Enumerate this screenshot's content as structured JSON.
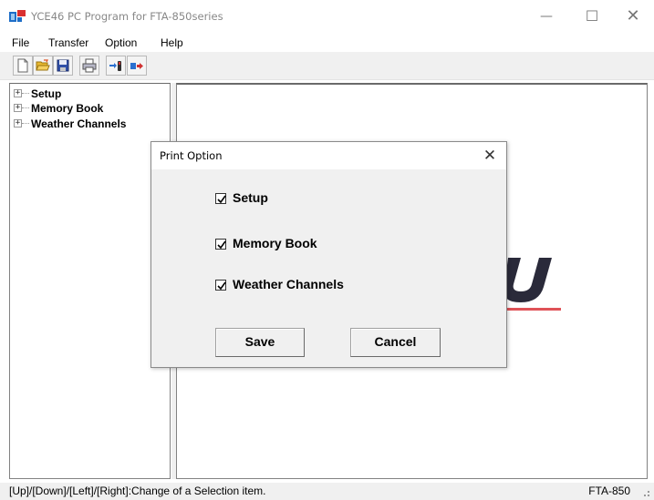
{
  "window": {
    "title": "YCE46 PC Program for FTA-850series",
    "controls": {
      "minimize": "—",
      "maximize": "☐",
      "close": "✕"
    }
  },
  "menu": {
    "items": [
      "File",
      "Transfer",
      "Option",
      "Help"
    ]
  },
  "toolbar": {
    "buttons": [
      "new-icon",
      "open-icon",
      "save-icon",
      "print-icon",
      "download-icon",
      "upload-icon"
    ]
  },
  "tree": {
    "nodes": [
      {
        "label": "Setup",
        "expander": "+"
      },
      {
        "label": "Memory Book",
        "expander": "+"
      },
      {
        "label": "Weather Channels",
        "expander": "+"
      }
    ]
  },
  "dialog": {
    "title": "Print Option",
    "close": "✕",
    "options": [
      {
        "label": "Setup",
        "checked": true
      },
      {
        "label": "Memory Book",
        "checked": true
      },
      {
        "label": "Weather Channels",
        "checked": true
      }
    ],
    "save_label": "Save",
    "cancel_label": "Cancel"
  },
  "status": {
    "hint": "[Up]/[Down]/[Left]/[Right]:Change of a Selection item.",
    "model": "FTA-850"
  },
  "colors": {
    "logo_dark": "#2a2a3a",
    "logo_accent": "#d9343a",
    "app_icon_blue": "#1e6ec8",
    "app_icon_red": "#d93030"
  }
}
